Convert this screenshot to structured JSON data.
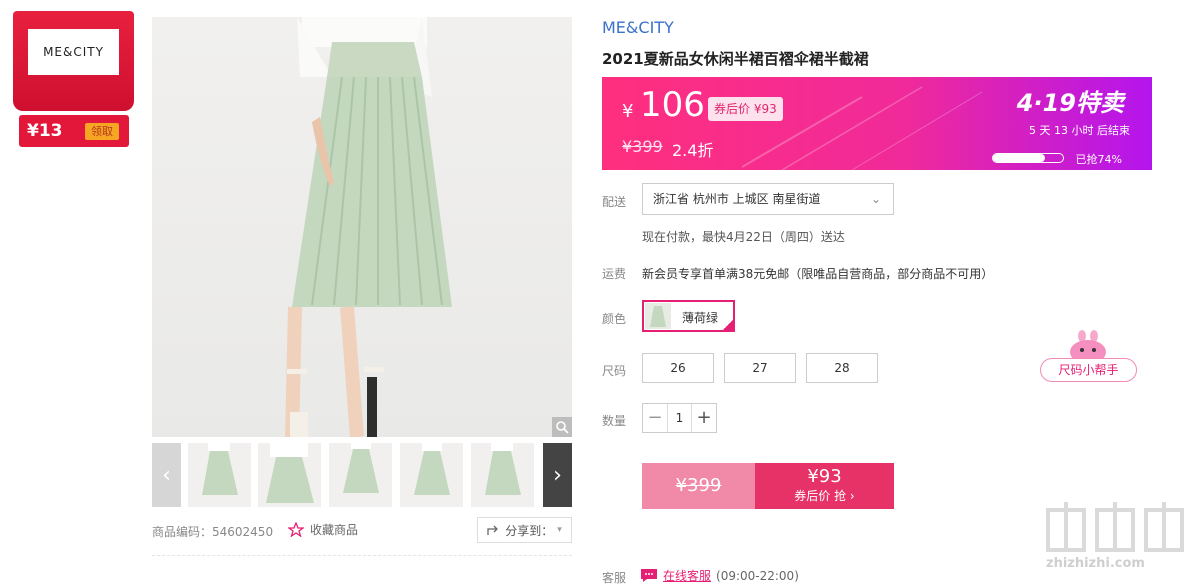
{
  "coupon": {
    "brand_logo": "ME&CITY",
    "amount": "¥13",
    "claim_label": "领取"
  },
  "gallery": {
    "zoom_icon": "magnifier-icon",
    "prev_icon": "chevron-left-icon",
    "next_icon": "chevron-right-icon"
  },
  "meta": {
    "sku": "商品编码：54602450",
    "favorite": "收藏商品",
    "share": "分享到："
  },
  "product": {
    "brand": "ME&CITY",
    "title": "2021夏新品女休闲半裙百褶伞裙半截裙"
  },
  "price": {
    "currency": "¥",
    "current": "106",
    "after_coupon": "券后价 ¥93",
    "original": "¥399",
    "discount": "2.4折",
    "promo_title": "4·19特卖",
    "countdown": "5  天  13  小时  后结束",
    "progress": 0.74,
    "sold": "已抢74%"
  },
  "delivery": {
    "label": "配送",
    "address": "浙江省 杭州市 上城区 南星街道",
    "note": "现在付款，最快4月22日（周四）送达"
  },
  "shipping": {
    "label": "运费",
    "text": "新会员专享首单满38元免邮（限唯品自营商品，部分商品不可用）"
  },
  "color": {
    "label": "颜色",
    "option": "薄荷绿"
  },
  "size": {
    "label": "尺码",
    "options": [
      "26",
      "27",
      "28"
    ],
    "helper": "尺码小帮手"
  },
  "quantity": {
    "label": "数量",
    "minus": "−",
    "value": "1",
    "plus": "+"
  },
  "buy": {
    "original": "¥399",
    "price": "¥93",
    "action": "券后价 抢 ›"
  },
  "service": {
    "label": "客服",
    "link": "在线客服",
    "hours": "(09:00-22:00)"
  },
  "watermark": {
    "text": "zhizhizhi.com"
  },
  "colors": {
    "accent": "#e51f73",
    "brand_blue": "#3a71c9",
    "coupon_red": "#e2173a"
  }
}
